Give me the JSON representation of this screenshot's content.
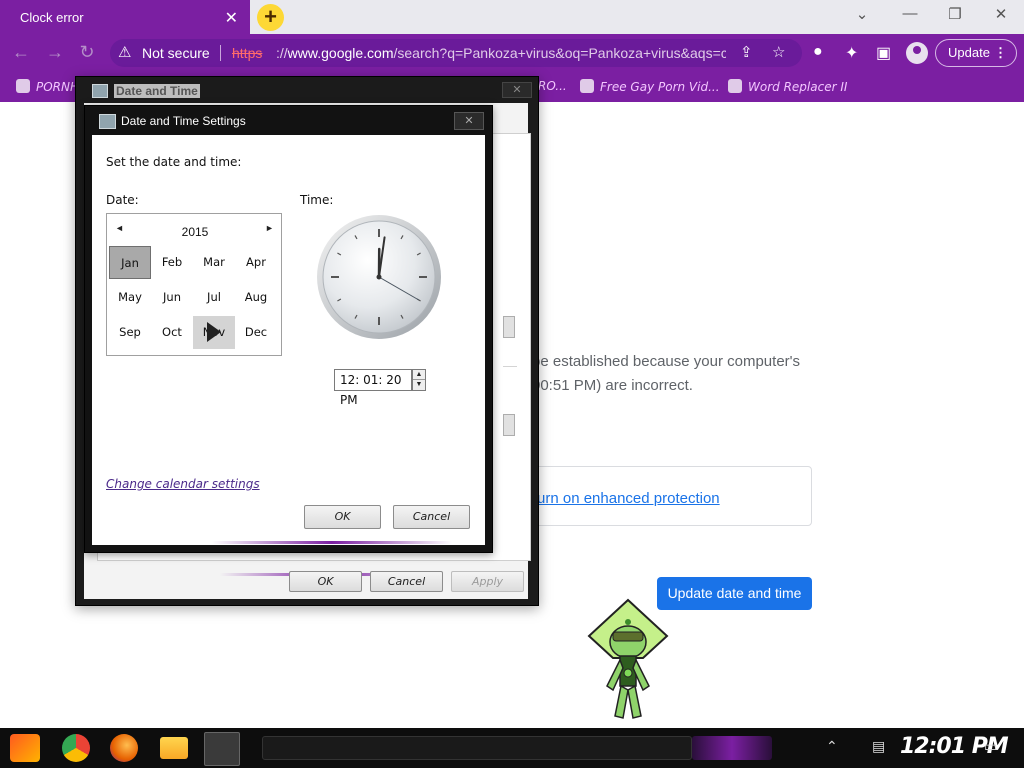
{
  "browser": {
    "tab_title": "Clock error",
    "tab_close": "✕",
    "new_tab": "+",
    "window_controls": {
      "minimize": "—",
      "restore": "❐",
      "close": "✕",
      "chevron": "⌄"
    },
    "security_label": "Not secure",
    "url_scheme": "https",
    "url_sep": "://",
    "url_domain": "www.google.com",
    "url_path": "/search?q=Pankoza+virus&oq=Pankoza+virus&aqs=c...",
    "update_label": "Update",
    "menu_dots": "⋮"
  },
  "bookmarks": [
    {
      "label": "PORNH"
    },
    {
      "label": "RO..."
    },
    {
      "label": "Free Gay Porn Vid..."
    },
    {
      "label": "Word Replacer II"
    }
  ],
  "page": {
    "body_line1": "be established because your computer's",
    "body_line2": "00:51 PM) are incorrect.",
    "protection_link": "urn on enhanced protection",
    "update_button": "Update date and time"
  },
  "outer_dialog": {
    "title": "Date and Time",
    "close": "✕",
    "buttons": {
      "ok": "OK",
      "cancel": "Cancel",
      "apply": "Apply"
    }
  },
  "inner_dialog": {
    "title": "Date and Time Settings",
    "close": "✕",
    "instruction": "Set the date and time:",
    "date_label": "Date:",
    "time_label": "Time:",
    "calendar": {
      "year": "2015",
      "prev": "◄",
      "next": "►",
      "months": [
        "Jan",
        "Feb",
        "Mar",
        "Apr",
        "May",
        "Jun",
        "Jul",
        "Aug",
        "Sep",
        "Oct",
        "Nov",
        "Dec"
      ],
      "selected_month": "Jan",
      "hover_month": "Nov"
    },
    "clock_hands": {
      "hour": 12,
      "minute": 1,
      "second": 20
    },
    "time_value": "12: 01: 20 PM",
    "spin_up": "▲",
    "spin_down": "▼",
    "change_calendar_link": "Change calendar settings",
    "buttons": {
      "ok": "OK",
      "cancel": "Cancel"
    }
  },
  "taskbar": {
    "time": "12:01 PM",
    "apps": [
      "start-icon",
      "chrome-icon",
      "firefox-icon",
      "file-explorer-icon",
      "date-time-icon"
    ]
  },
  "colors": {
    "theme_purple": "#7b1fa2",
    "link_blue": "#1a73e8",
    "warning_red": "#ff6b6b"
  }
}
